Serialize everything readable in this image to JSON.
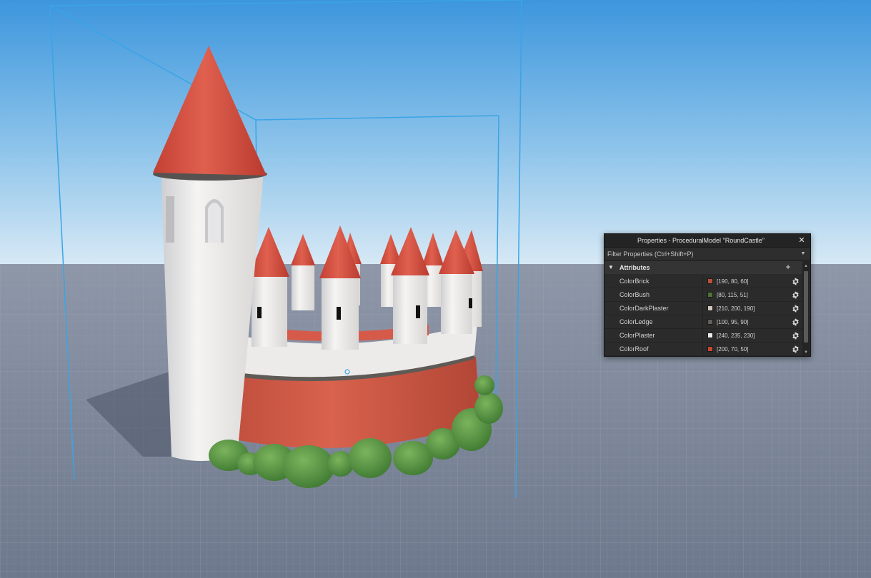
{
  "colors": {
    "sky_top": "#4a9fe0",
    "sky_bottom": "#cde4f3",
    "ground": "#7a8499",
    "selection_box": "#3aa4e6",
    "roof": "#cf4a3d",
    "brick": "#c85a46",
    "plaster": "#f0ebe6",
    "bush": "#5e9a45",
    "panel_bg": "#2b2b2b"
  },
  "properties_panel": {
    "title": "Properties - ProceduralModel \"RoundCastle\"",
    "close_icon": "close-icon",
    "filter_placeholder": "Filter Properties (Ctrl+Shift+P)",
    "section": {
      "title": "Attributes",
      "add_icon": "plus-icon",
      "expanded": true
    },
    "attributes": [
      {
        "name": "ColorBrick",
        "value": "[190, 80, 60]",
        "swatch": "#be503c"
      },
      {
        "name": "ColorBush",
        "value": "[80, 115, 51]",
        "swatch": "#507333"
      },
      {
        "name": "ColorDarkPlaster",
        "value": "[210, 200, 190]",
        "swatch": "#d2c8be"
      },
      {
        "name": "ColorLedge",
        "value": "[100, 95, 90]",
        "swatch": "#645f5a"
      },
      {
        "name": "ColorPlaster",
        "value": "[240, 235, 230]",
        "swatch": "#f0ebe6"
      },
      {
        "name": "ColorRoof",
        "value": "[200, 70, 50]",
        "swatch": "#c84632"
      }
    ]
  }
}
